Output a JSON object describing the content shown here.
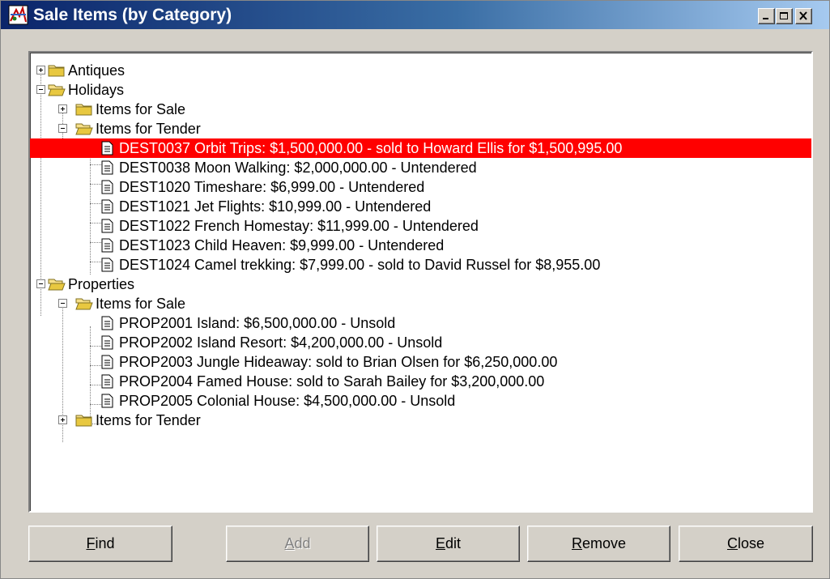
{
  "window": {
    "title": "Sale Items (by Category)",
    "controls": [
      "minimize-icon",
      "maximize-icon",
      "close-icon"
    ],
    "colors": {
      "title_start": "#0a246a",
      "title_end": "#a6caf0",
      "selection": "#ff0000"
    }
  },
  "tree": {
    "nodes": [
      {
        "label": "Antiques",
        "icon": "folder-closed-icon",
        "expander": "plus"
      },
      {
        "label": "Holidays",
        "icon": "folder-open-icon",
        "expander": "minus"
      },
      {
        "label": "Items for Sale",
        "icon": "folder-closed-icon",
        "expander": "plus"
      },
      {
        "label": "Items for Tender",
        "icon": "folder-open-icon",
        "expander": "minus"
      },
      {
        "label": "DEST0037 Orbit Trips: $1,500,000.00 - sold to Howard Ellis for $1,500,995.00",
        "icon": "document-icon",
        "selected": true
      },
      {
        "label": "DEST0038 Moon Walking: $2,000,000.00 - Untendered",
        "icon": "document-icon"
      },
      {
        "label": "DEST1020 Timeshare: $6,999.00 - Untendered",
        "icon": "document-icon"
      },
      {
        "label": "DEST1021 Jet Flights: $10,999.00 - Untendered",
        "icon": "document-icon"
      },
      {
        "label": "DEST1022 French Homestay: $11,999.00 - Untendered",
        "icon": "document-icon"
      },
      {
        "label": "DEST1023 Child Heaven: $9,999.00 - Untendered",
        "icon": "document-icon"
      },
      {
        "label": "DEST1024 Camel trekking: $7,999.00 - sold to David Russel for $8,955.00",
        "icon": "document-icon"
      },
      {
        "label": "Properties",
        "icon": "folder-open-icon",
        "expander": "minus"
      },
      {
        "label": "Items for Sale",
        "icon": "folder-open-icon",
        "expander": "minus"
      },
      {
        "label": "PROP2001 Island: $6,500,000.00 - Unsold",
        "icon": "document-icon"
      },
      {
        "label": "PROP2002 Island Resort: $4,200,000.00 - Unsold",
        "icon": "document-icon"
      },
      {
        "label": "PROP2003 Jungle Hideaway: sold to Brian Olsen for $6,250,000.00",
        "icon": "document-icon"
      },
      {
        "label": "PROP2004 Famed House: sold to Sarah Bailey for $3,200,000.00",
        "icon": "document-icon"
      },
      {
        "label": "PROP2005 Colonial House: $4,500,000.00 - Unsold",
        "icon": "document-icon"
      },
      {
        "label": "Items for Tender",
        "icon": "folder-closed-icon",
        "expander": "plus"
      }
    ]
  },
  "buttons": [
    {
      "first": "F",
      "rest": "ind",
      "enabled": true
    },
    {
      "first": "A",
      "rest": "dd",
      "enabled": false
    },
    {
      "first": "E",
      "rest": "dit",
      "enabled": true
    },
    {
      "first": "R",
      "rest": "emove",
      "enabled": true
    },
    {
      "first": "C",
      "rest": "lose",
      "enabled": true
    }
  ]
}
